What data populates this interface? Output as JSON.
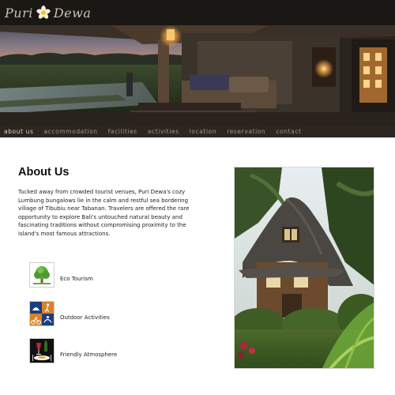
{
  "brand": {
    "name_part1": "Puri",
    "name_part2": "Dewa",
    "flower_icon": "frangipani-flower-icon"
  },
  "nav": {
    "items": [
      {
        "label": "about us",
        "active": true
      },
      {
        "label": "accommodation",
        "active": false
      },
      {
        "label": "facilities",
        "active": false
      },
      {
        "label": "activities",
        "active": false
      },
      {
        "label": "location",
        "active": false
      },
      {
        "label": "reservation",
        "active": false
      },
      {
        "label": "contact",
        "active": false
      }
    ]
  },
  "main": {
    "title": "About Us",
    "intro": "Tucked away from crowded tourist venues, Puri Dewa's cozy Lumbung bungalows lie in the calm and restful sea bordering village of Tibubiu near Tabanan. Travelers are offered the rare opportunity to explore Bali's untouched natural beauty and fascinating traditions without compromising proximity to the island's most famous attractions.",
    "features": [
      {
        "label": "Eco Tourism",
        "icon": "tree-icon"
      },
      {
        "label": "Outdoor Activities",
        "icon": "outdoor-activities-icon"
      },
      {
        "label": "Friendly Atmosphere",
        "icon": "dining-icon"
      }
    ]
  },
  "colors": {
    "header_bg": "#1a1714",
    "nav_bg": "#2a2622",
    "nav_text": "#9c958a",
    "nav_active": "#d9d2c6",
    "brand_text": "#c9c3b8",
    "flower": "#f2c23a"
  }
}
